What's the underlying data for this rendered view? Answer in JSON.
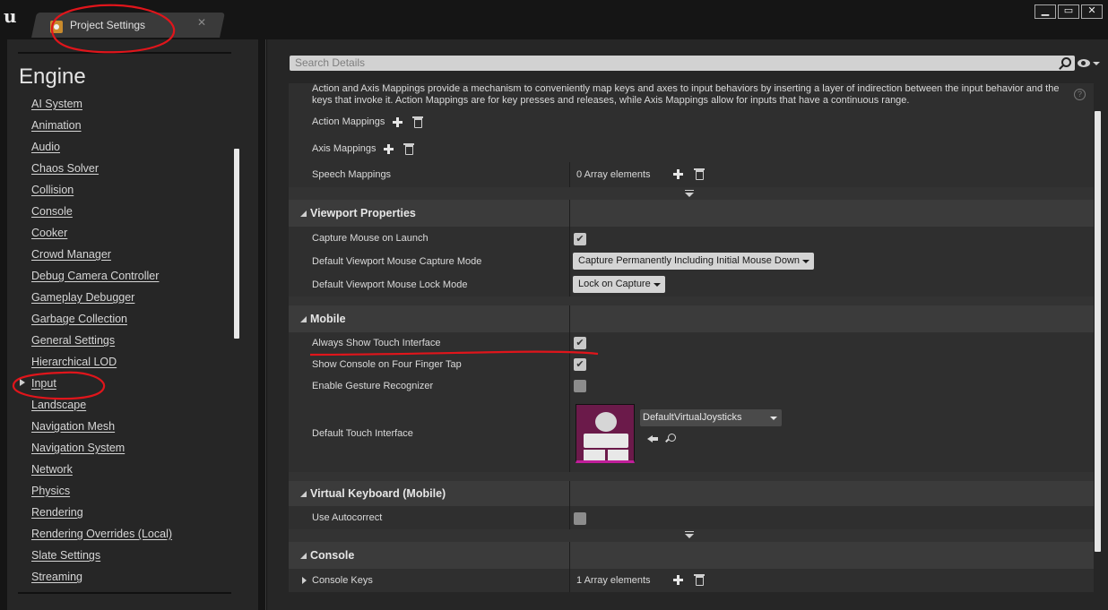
{
  "window": {
    "tab_title": "Project Settings",
    "tab_close": "✕",
    "minimize": "▁",
    "maximize": "▭",
    "close": "✕",
    "logo": "u"
  },
  "sidebar": {
    "section_title": "Engine",
    "items": [
      {
        "label": "AI System"
      },
      {
        "label": "Animation"
      },
      {
        "label": "Audio"
      },
      {
        "label": "Chaos Solver"
      },
      {
        "label": "Collision"
      },
      {
        "label": "Console"
      },
      {
        "label": "Cooker"
      },
      {
        "label": "Crowd Manager"
      },
      {
        "label": "Debug Camera Controller"
      },
      {
        "label": "Gameplay Debugger"
      },
      {
        "label": "Garbage Collection"
      },
      {
        "label": "General Settings"
      },
      {
        "label": "Hierarchical LOD"
      },
      {
        "label": "Input",
        "selected": true
      },
      {
        "label": "Landscape"
      },
      {
        "label": "Navigation Mesh"
      },
      {
        "label": "Navigation System"
      },
      {
        "label": "Network"
      },
      {
        "label": "Physics"
      },
      {
        "label": "Rendering"
      },
      {
        "label": "Rendering Overrides (Local)"
      },
      {
        "label": "Slate Settings"
      },
      {
        "label": "Streaming"
      }
    ]
  },
  "search": {
    "placeholder": "Search Details"
  },
  "bindings": {
    "description": "Action and Axis Mappings provide a mechanism to conveniently map keys and axes to input behaviors by inserting a layer of indirection between the input behavior and the keys that invoke it. Action Mappings are for key presses and releases, while Axis Mappings allow for inputs that have a continuous range.",
    "help": "?",
    "action_mappings": "Action Mappings",
    "axis_mappings": "Axis Mappings",
    "speech_mappings": "Speech Mappings",
    "speech_value": "0 Array elements"
  },
  "viewport": {
    "title": "Viewport Properties",
    "capture_mouse_label": "Capture Mouse on Launch",
    "capture_mouse_checked": true,
    "capture_mode_label": "Default Viewport Mouse Capture Mode",
    "capture_mode_value": "Capture Permanently Including Initial Mouse Down",
    "lock_mode_label": "Default Viewport Mouse Lock Mode",
    "lock_mode_value": "Lock on Capture"
  },
  "mobile": {
    "title": "Mobile",
    "always_show_label": "Always Show Touch Interface",
    "always_show_checked": true,
    "four_finger_label": "Show Console on Four Finger Tap",
    "four_finger_checked": true,
    "gesture_label": "Enable Gesture Recognizer",
    "gesture_checked": false,
    "touch_interface_label": "Default Touch Interface",
    "touch_interface_value": "DefaultVirtualJoysticks"
  },
  "virtual_keyboard": {
    "title": "Virtual Keyboard (Mobile)",
    "autocorrect_label": "Use Autocorrect",
    "autocorrect_checked": false
  },
  "console": {
    "title": "Console",
    "keys_label": "Console Keys",
    "keys_value": "1 Array elements"
  },
  "icons": {
    "checkmark": "✔"
  },
  "colors": {
    "annotation": "#e0151b",
    "panel": "#262626",
    "category": "#3b3b3b",
    "thumbnail": "#6b1a4a"
  }
}
